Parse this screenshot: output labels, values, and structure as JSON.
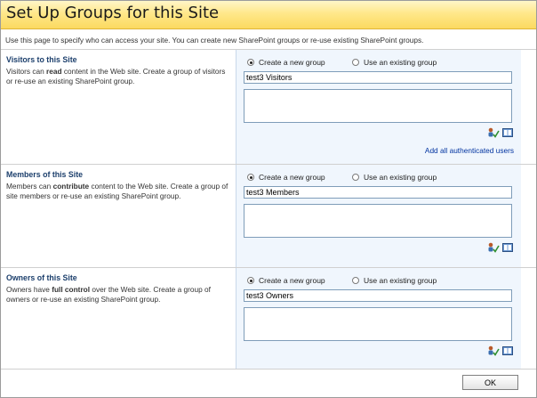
{
  "page": {
    "title": "Set Up Groups for this Site",
    "intro": "Use this page to specify who can access your site. You can create new SharePoint groups or re-use existing SharePoint groups."
  },
  "radios": {
    "create_label": "Create a new group",
    "existing_label": "Use an existing group"
  },
  "visitors": {
    "title": "Visitors to this Site",
    "desc_prefix": "Visitors can ",
    "desc_verb": "read",
    "desc_suffix": " content in the Web site. Create a group of visitors or re-use an existing SharePoint group.",
    "group_name": "test3 Visitors",
    "link": "Add all authenticated users"
  },
  "members": {
    "title": "Members of this Site",
    "desc_prefix": "Members can ",
    "desc_verb": "contribute",
    "desc_suffix": " content to the Web site. Create a group of site members or re-use an existing SharePoint group.",
    "group_name": "test3 Members"
  },
  "owners": {
    "title": "Owners of this Site",
    "desc_prefix": "Owners have ",
    "desc_verb": "full control",
    "desc_suffix": " over the Web site. Create a group of owners or re-use an existing SharePoint group.",
    "group_name": "test3 Owners"
  },
  "footer": {
    "ok_label": "OK"
  },
  "colors": {
    "accent": "#ffe88a",
    "link": "#0033a0",
    "panel": "#f0f6fd"
  },
  "icons": [
    "check-names-icon",
    "browse-address-book-icon"
  ]
}
